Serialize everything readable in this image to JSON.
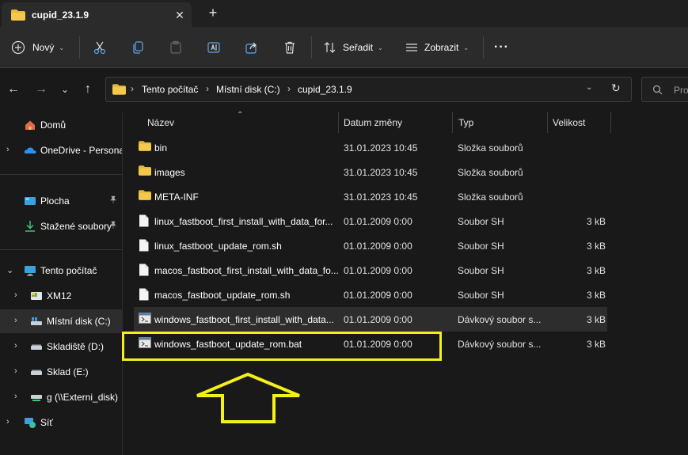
{
  "tab": {
    "title": "cupid_23.1.9",
    "close": "✕",
    "new": "+"
  },
  "toolbar": {
    "new_label": "Nový",
    "sort_label": "Seřadit",
    "view_label": "Zobrazit",
    "more": "···",
    "caret": "⌄"
  },
  "nav": {
    "back": "←",
    "forward": "→",
    "recent": "⌄",
    "up": "↑",
    "refresh": "↻",
    "breadcrumbs": [
      "Tento počítač",
      "Místní disk (C:)",
      "cupid_23.1.9"
    ],
    "separator": "›",
    "dropdown": "⌄",
    "search_placeholder": "Pro"
  },
  "sidebar": {
    "items": [
      {
        "label": "Domů",
        "icon": "home-icon",
        "chevron": ""
      },
      {
        "label": "OneDrive - Persona",
        "icon": "onedrive-icon",
        "chevron": "›"
      },
      {
        "label": "Plocha",
        "icon": "desktop-icon",
        "chevron": "",
        "pin": "📌"
      },
      {
        "label": "Stažené soubory",
        "icon": "download-icon",
        "chevron": "",
        "pin": "📌"
      },
      {
        "label": "Tento počítač",
        "icon": "computer-icon",
        "chevron": "⌄"
      },
      {
        "label": "XM12",
        "icon": "drive-icon",
        "chevron": "›"
      },
      {
        "label": "Místní disk (C:)",
        "icon": "drive-icon",
        "chevron": "›"
      },
      {
        "label": "Skladiště (D:)",
        "icon": "drive-icon",
        "chevron": "›"
      },
      {
        "label": "Sklad (E:)",
        "icon": "drive-icon",
        "chevron": "›"
      },
      {
        "label": "g (\\\\Externi_disk)",
        "icon": "network-drive-icon",
        "chevron": "›"
      },
      {
        "label": "Síť",
        "icon": "network-icon",
        "chevron": "›"
      }
    ]
  },
  "columns": {
    "name": "Název",
    "date": "Datum změny",
    "type": "Typ",
    "size": "Velikost",
    "sort": "⌃"
  },
  "files": [
    {
      "name": "bin",
      "date": "31.01.2023 10:45",
      "type": "Složka souborů",
      "size": "",
      "icon": "folder-icon"
    },
    {
      "name": "images",
      "date": "31.01.2023 10:45",
      "type": "Složka souborů",
      "size": "",
      "icon": "folder-icon"
    },
    {
      "name": "META-INF",
      "date": "31.01.2023 10:45",
      "type": "Složka souborů",
      "size": "",
      "icon": "folder-icon"
    },
    {
      "name": "linux_fastboot_first_install_with_data_for...",
      "date": "01.01.2009 0:00",
      "type": "Soubor SH",
      "size": "3 kB",
      "icon": "file-icon"
    },
    {
      "name": "linux_fastboot_update_rom.sh",
      "date": "01.01.2009 0:00",
      "type": "Soubor SH",
      "size": "3 kB",
      "icon": "file-icon"
    },
    {
      "name": "macos_fastboot_first_install_with_data_fo...",
      "date": "01.01.2009 0:00",
      "type": "Soubor SH",
      "size": "3 kB",
      "icon": "file-icon"
    },
    {
      "name": "macos_fastboot_update_rom.sh",
      "date": "01.01.2009 0:00",
      "type": "Soubor SH",
      "size": "3 kB",
      "icon": "file-icon"
    },
    {
      "name": "windows_fastboot_first_install_with_data...",
      "date": "01.01.2009 0:00",
      "type": "Dávkový soubor s...",
      "size": "3 kB",
      "icon": "batch-file-icon"
    },
    {
      "name": "windows_fastboot_update_rom.bat",
      "date": "01.01.2009 0:00",
      "type": "Dávkový soubor s...",
      "size": "3 kB",
      "icon": "batch-file-icon"
    }
  ],
  "colors": {
    "accent": "#f5ef1a",
    "folder": "#e8b83a",
    "background": "#191919",
    "selected_row": "#2d2d2d"
  }
}
